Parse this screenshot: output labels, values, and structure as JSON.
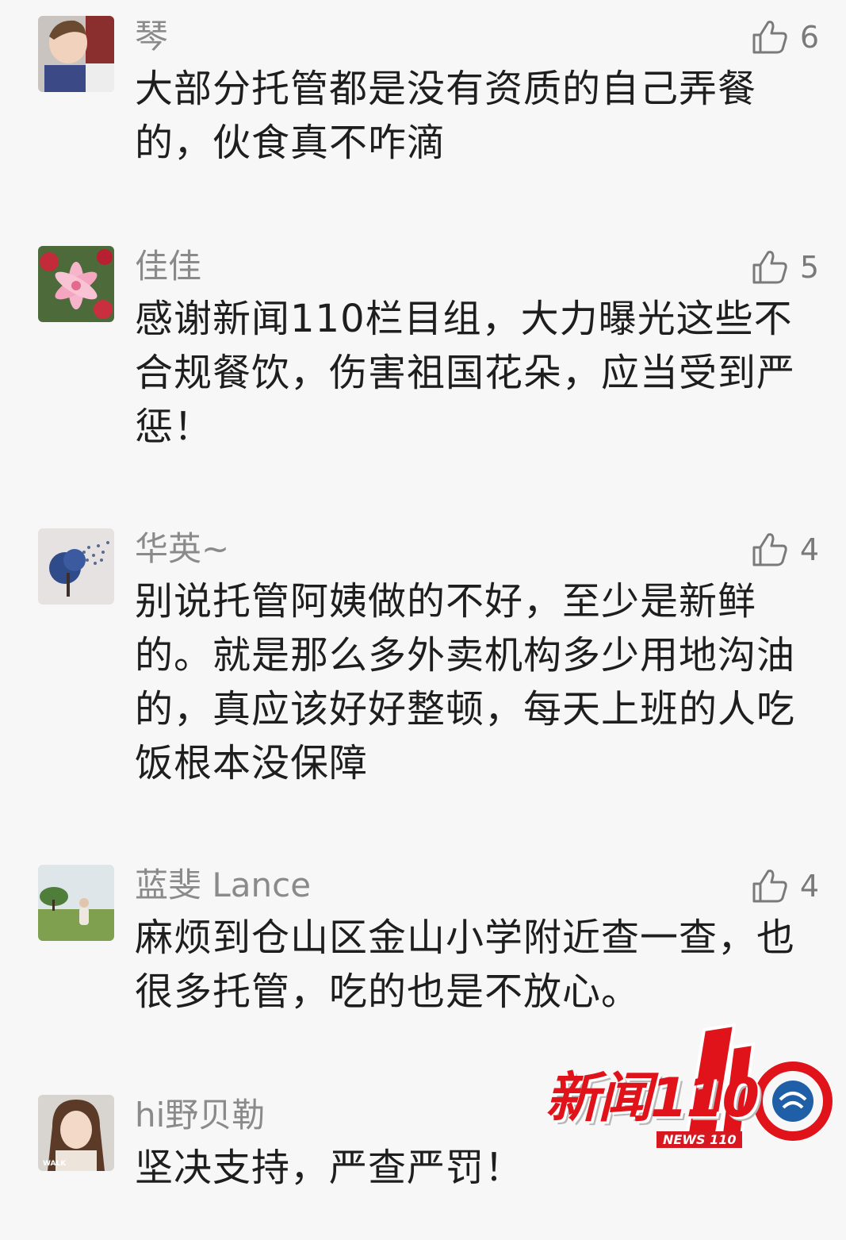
{
  "comments": [
    {
      "avatar": "boy-photo-avatar",
      "name": "琴",
      "likes": "6",
      "lines": [
        "大部分托管都是没有资质的自己弄餐",
        "的，伙食真不咋滴"
      ]
    },
    {
      "avatar": "lily-flower-avatar",
      "name": "佳佳",
      "likes": "5",
      "lines": [
        "感谢新闻110栏目组，大力曝光这些不",
        "合规餐饮，伤害祖国花朵，应当受到严",
        "惩！"
      ]
    },
    {
      "avatar": "tree-birds-avatar",
      "name": "华英~",
      "likes": "4",
      "lines": [
        "别说托管阿姨做的不好，至少是新鲜",
        "的。就是那么多外卖机构多少用地沟油",
        "的，真应该好好整顿，每天上班的人吃",
        "饭根本没保障"
      ]
    },
    {
      "avatar": "child-field-avatar",
      "name": "蓝斐 Lance",
      "likes": "4",
      "lines": [
        "麻烦到仓山区金山小学附近查一查，也",
        "很多托管，吃的也是不放心。"
      ]
    },
    {
      "avatar": "girl-photo-avatar",
      "name": "hi野贝勒",
      "likes": "",
      "lines": [
        "坚决支持，严查严罚！"
      ]
    }
  ],
  "watermark": {
    "title": "新闻110",
    "subtitle": "NEWS 110",
    "avatar_caption": "WALK"
  },
  "colors": {
    "background": "#f7f7f7",
    "name_text": "#8a8a8a",
    "body_text": "#1e1e1e",
    "like_icon": "#7a7a7a",
    "logo_red": "#e0131b",
    "logo_blue": "#1f5fa8"
  }
}
